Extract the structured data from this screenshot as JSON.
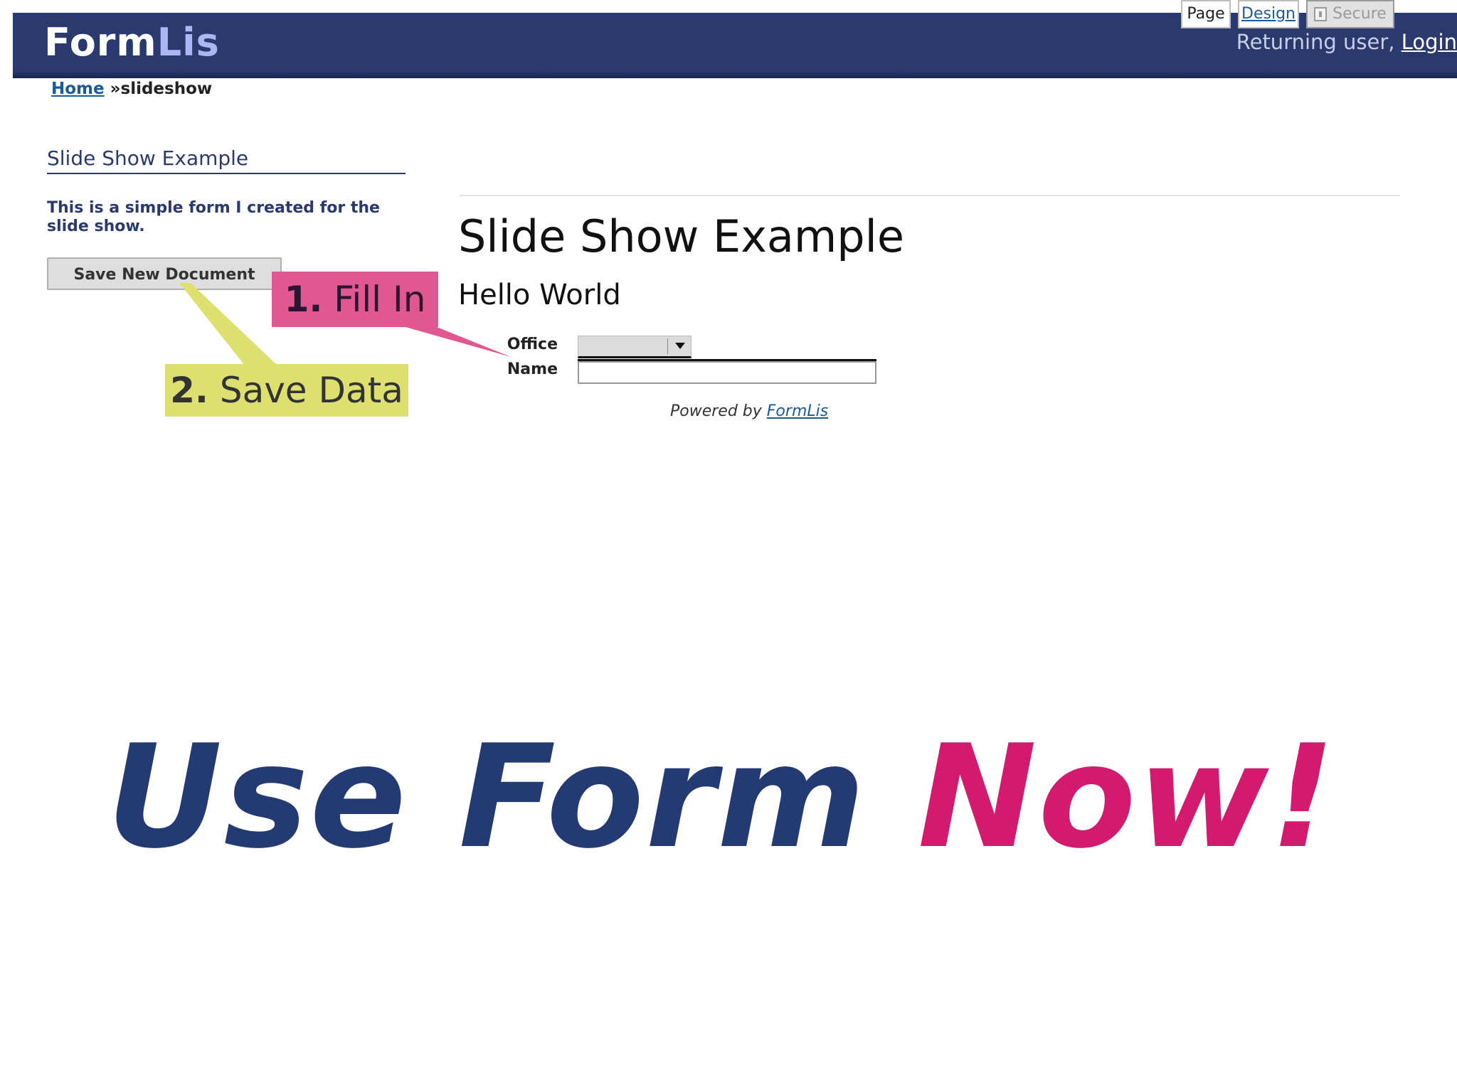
{
  "header": {
    "logo_part1": "Form",
    "logo_part2": "Lis",
    "user_prefix": "Returning user,",
    "login_label": "Login"
  },
  "breadcrumb": {
    "home_label": "Home",
    "separator": "»",
    "current": "slideshow"
  },
  "sidebar": {
    "title": "Slide Show Example",
    "description": "This is a simple form I created for the slide show.",
    "save_button_label": "Save New Document"
  },
  "tabs": [
    {
      "label": "Page"
    },
    {
      "label": "Design"
    },
    {
      "label": "Secure"
    }
  ],
  "form": {
    "title": "Slide Show Example",
    "subtitle": "Hello World",
    "fields": {
      "office_label": "Office",
      "office_value": "",
      "name_label": "Name",
      "name_value": ""
    },
    "powered_prefix": "Powered by",
    "powered_link": "FormLis"
  },
  "callouts": {
    "fill_number": "1.",
    "fill_text": "Fill In",
    "save_number": "2.",
    "save_text": "Save Data"
  },
  "slogan": {
    "part1": "Use Form ",
    "part2": "Now!"
  },
  "colors": {
    "header_bg": "#2b3a6e",
    "brand_light": "#a9b8f2",
    "link": "#1a5a9a",
    "callout_pink": "#e0588f",
    "callout_yellow": "#dde06f",
    "slogan_blue": "#243a73",
    "slogan_pink": "#d41a6e"
  },
  "icons": [
    "lock-icon",
    "chevron-down-icon"
  ]
}
